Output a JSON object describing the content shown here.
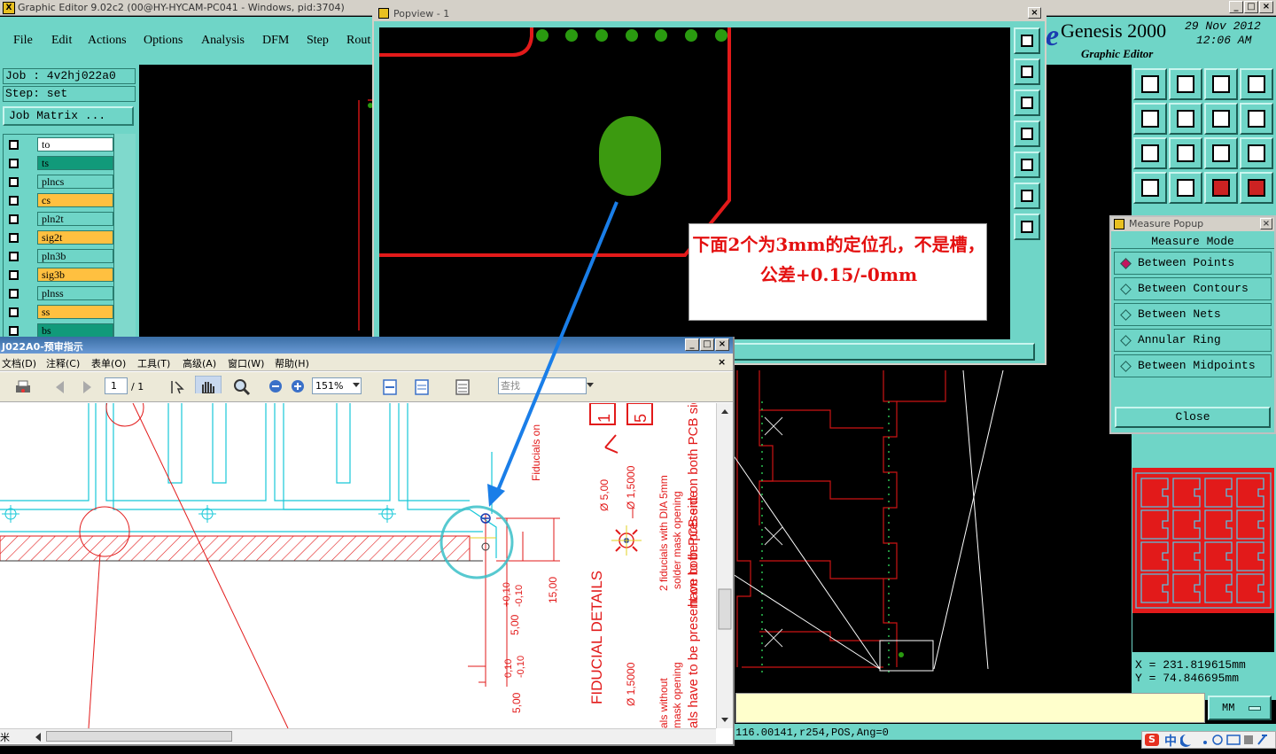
{
  "main_window": {
    "title": "Graphic Editor 9.02c2 (00@HY-HYCAM-PC041 - Windows, pid:3704)",
    "min": "_",
    "max": "□",
    "close": "×"
  },
  "menu": [
    "File",
    "Edit",
    "Actions",
    "Options",
    "Analysis",
    "DFM",
    "Step",
    "Rout"
  ],
  "brand": {
    "name": "Genesis 2000",
    "subtitle": "Graphic Editor",
    "date": "29 Nov 2012",
    "time": "12:06 AM"
  },
  "job": {
    "job_line": "Job : 4v2hj022a0",
    "step_line": "Step: set",
    "matrix_button": "Job Matrix ..."
  },
  "layers": [
    {
      "name": "to",
      "color": "#ffffff"
    },
    {
      "name": "ts",
      "color": "#119a7a"
    },
    {
      "name": "plncs",
      "color": "#6fd5c7"
    },
    {
      "name": "cs",
      "color": "#ffc040"
    },
    {
      "name": "pln2t",
      "color": "#6fd5c7"
    },
    {
      "name": "sig2t",
      "color": "#ffc040"
    },
    {
      "name": "pln3b",
      "color": "#6fd5c7"
    },
    {
      "name": "sig3b",
      "color": "#ffc040"
    },
    {
      "name": "plnss",
      "color": "#6fd5c7"
    },
    {
      "name": "ss",
      "color": "#ffc040"
    },
    {
      "name": "bs",
      "color": "#119a7a"
    }
  ],
  "popview": {
    "title": "Popview - 1",
    "close": "×",
    "annotation": "下面2个为3mm的定位孔，不是槽，公差+0.15/-0mm"
  },
  "measure": {
    "title": "Measure Popup",
    "close_x": "×",
    "mode_label": "Measure Mode",
    "options": [
      {
        "label": "Between Points",
        "selected": true
      },
      {
        "label": "Between Contours",
        "selected": false
      },
      {
        "label": "Between Nets",
        "selected": false
      },
      {
        "label": "Annular Ring",
        "selected": false
      },
      {
        "label": "Between Midpoints",
        "selected": false
      }
    ],
    "close_button": "Close"
  },
  "coords": {
    "x": "X  =  231.819615mm",
    "y": "Y  =  74.846695mm"
  },
  "status": {
    "readout": "116.00141,r254,POS,Ang=0",
    "unit": "MM"
  },
  "tray": {
    "ime": "中"
  },
  "pdf": {
    "title": "J022A0-预审指示",
    "menu": [
      "文档(D)",
      "注释(C)",
      "表单(O)",
      "工具(T)",
      "高级(A)",
      "窗口(W)",
      "帮助(H)"
    ],
    "close_x": "×",
    "page_current": "1",
    "page_total": "/ 1",
    "zoom": "151%",
    "search_placeholder": "查找",
    "hscroll_label": "米",
    "drawing_texts": {
      "fiducial_details": "FIDUCIAL DETAILS",
      "fiducials_dia": "2 fiducials with DIA 5mm",
      "solder_mask": "solder mask opening",
      "both_sides": "have to be present on both PCB side",
      "dia5": "Ø 5,00",
      "dia15": "Ø 1,5000",
      "dia15b": "Ø 1,5000",
      "fid_on": "Fiducials on",
      "tol1": "5,00",
      "tol1p": "+0,10",
      "tol1m": "-0,10",
      "tol2": "5,00",
      "tol2p": "0,10",
      "tol2m": "-0,10",
      "dim15": "15,00",
      "als_without": "als without",
      "mask_opening": "mask opening",
      "als_have": "als have to be present on both PCB side",
      "box_1": "1",
      "box_5": "5"
    }
  }
}
